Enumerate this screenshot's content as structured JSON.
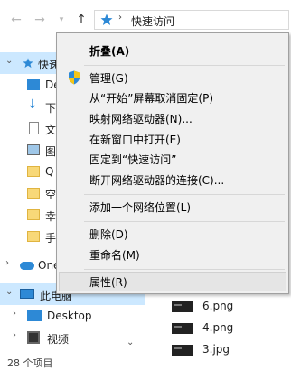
{
  "address": {
    "path": "快速访问",
    "separator": "›"
  },
  "nav_items": [
    {
      "label": "快速",
      "top": 0,
      "level": 0
    },
    {
      "label": "De",
      "level": 1
    },
    {
      "label": "下",
      "level": 1
    },
    {
      "label": "文",
      "level": 1
    },
    {
      "label": "图",
      "level": 1
    },
    {
      "label": "Q",
      "level": 1
    },
    {
      "label": "空",
      "level": 1
    },
    {
      "label": "幸",
      "level": 1
    },
    {
      "label": "手",
      "level": 1
    }
  ],
  "nav_other": {
    "onedrive": "One",
    "this_pc": "此电脑",
    "desktop": "Desktop",
    "videos": "视频"
  },
  "files": [
    "6.png",
    "4.png",
    "3.jpg"
  ],
  "status": "28 个项目",
  "menu": {
    "items": [
      {
        "label": "折叠(A)"
      },
      {
        "label": "管理(G)"
      },
      {
        "label": "从“开始”屏幕取消固定(P)"
      },
      {
        "label": "映射网络驱动器(N)..."
      },
      {
        "label": "在新窗口中打开(E)"
      },
      {
        "label": "固定到“快速访问”"
      },
      {
        "label": "断开网络驱动器的连接(C)..."
      },
      {
        "label": "添加一个网络位置(L)"
      },
      {
        "label": "删除(D)"
      },
      {
        "label": "重命名(M)"
      },
      {
        "label": "属性(R)"
      }
    ]
  },
  "colors": {
    "selection": "#cce8ff",
    "accent": "#2d89d6",
    "folder": "#f8d878"
  }
}
